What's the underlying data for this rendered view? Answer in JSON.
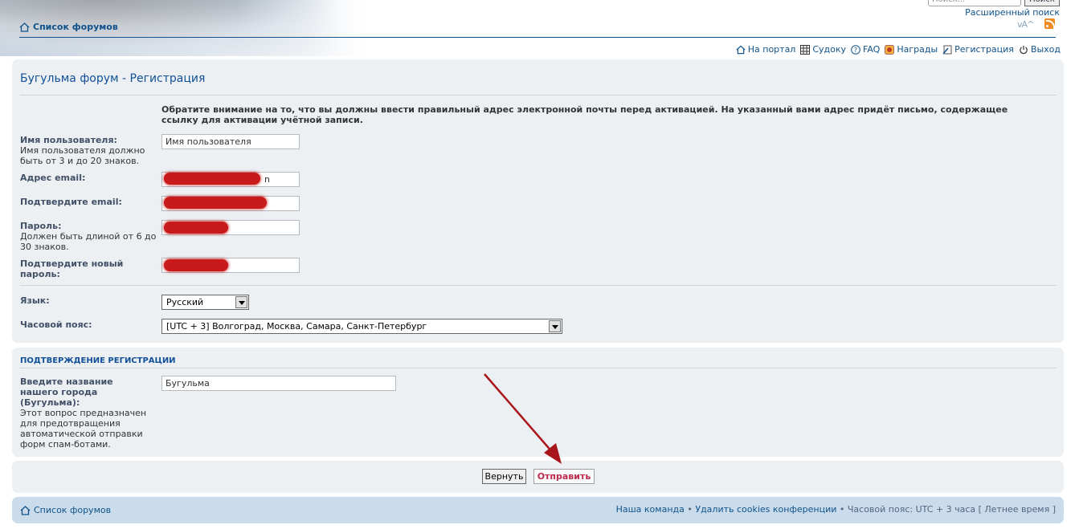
{
  "header": {
    "forum_index": "Список форумов",
    "search_placeholder": "Поиск...",
    "search_button": "Поиск",
    "advanced_search": "Расширенный поиск",
    "font_size": "vA^",
    "colors": {
      "link": "#105289",
      "panel": "#ecf0f3",
      "footer": "#cadceb"
    }
  },
  "nav": [
    {
      "label": "На портал",
      "icon": "home-icon"
    },
    {
      "label": "Судоку",
      "icon": "grid-icon"
    },
    {
      "label": "FAQ",
      "icon": "help-icon"
    },
    {
      "label": "Награды",
      "icon": "award-icon"
    },
    {
      "label": "Регистрация",
      "icon": "register-icon"
    },
    {
      "label": "Выход",
      "icon": "power-icon"
    }
  ],
  "form": {
    "title": "Бугульма форум - Регистрация",
    "notice": "Обратите внимание на то, что вы должны ввести правильный адрес электронной почты перед активацией. На указанный вами адрес придёт письмо, содержащее ссылку для активации учётной записи.",
    "username_label": "Имя пользователя:",
    "username_hint": "Имя пользователя должно быть от 3 и до 20 знаков.",
    "username_value": "Имя пользователя",
    "email_label": "Адрес email:",
    "email_value_tail": "n",
    "email_confirm_label": "Подтвердите email:",
    "password_label": "Пароль:",
    "password_hint": "Должен быть длиной от 6 до 30 знаков.",
    "password_confirm_label": "Подтвердите новый пароль:",
    "language_label": "Язык:",
    "language_value": "Русский",
    "timezone_label": "Часовой пояс:",
    "timezone_value": "[UTC + 3] Волгоград, Москва, Самара, Санкт-Петербург"
  },
  "confirm": {
    "title": "Подтверждение регистрации",
    "question_label": "Введите название нашего города (Бугульма):",
    "question_hint": "Этот вопрос предназначен для предотвращения автоматической отправки форм спам-ботами.",
    "answer_value": "Бугульма"
  },
  "buttons": {
    "back": "Вернуть",
    "submit": "Отправить"
  },
  "footer": {
    "forum_index": "Список форумов",
    "team": "Наша команда",
    "sep1": " • ",
    "delete_cookies": "Удалить cookies конференции",
    "sep2": " • ",
    "timezone": "Часовой пояс: UTC + 3 часа [ Летнее время ]"
  }
}
